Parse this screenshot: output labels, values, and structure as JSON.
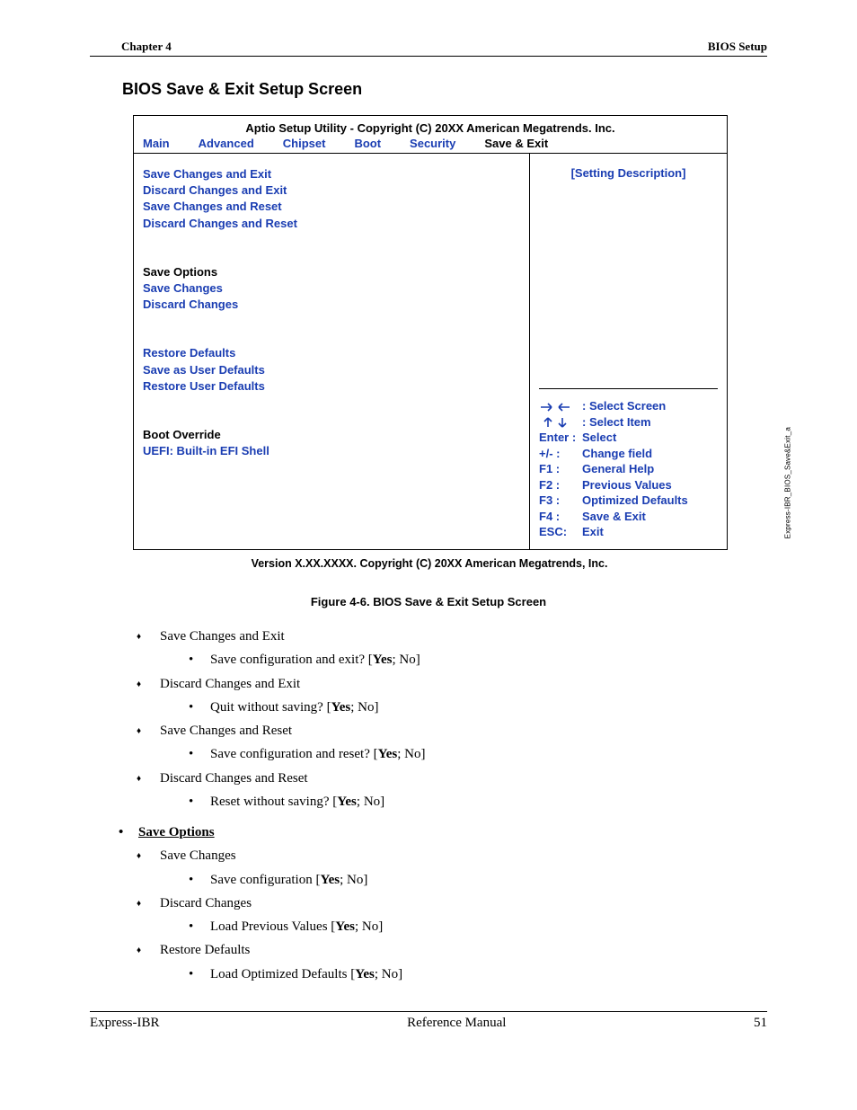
{
  "header": {
    "chapter": "Chapter 4",
    "section": "BIOS Setup"
  },
  "title": "BIOS Save & Exit Setup Screen",
  "bios": {
    "utility_title": "Aptio Setup Utility - Copyright (C) 20XX American Megatrends. Inc.",
    "tabs": [
      "Main",
      "Advanced",
      "Chipset",
      "Boot",
      "Security",
      "Save & Exit"
    ],
    "group1": [
      "Save Changes and Exit",
      "Discard Changes and Exit",
      "Save Changes and Reset",
      "Discard Changes and Reset"
    ],
    "group2_header": "Save Options",
    "group2": [
      "Save Changes",
      "Discard Changes"
    ],
    "group3": [
      "Restore Defaults",
      "Save as User Defaults",
      "Restore User Defaults"
    ],
    "group4_header": "Boot Override",
    "group4": [
      "UEFI: Built-in EFI Shell"
    ],
    "setting_desc": "[Setting Description]",
    "help": {
      "select_screen": "Select Screen",
      "select_item": "Select Item",
      "enter": "Enter :",
      "enter_v": "Select",
      "pm": "+/- :",
      "pm_v": "Change field",
      "f1": "F1 :",
      "f1_v": "General Help",
      "f2": "F2 :",
      "f2_v": "Previous Values",
      "f3": "F3 :",
      "f3_v": "Optimized Defaults",
      "f4": "F4 :",
      "f4_v": "Save & Exit",
      "esc": "ESC:",
      "esc_v": "Exit"
    },
    "version": "Version X.XX.XXXX.  Copyright (C) 20XX  American Megatrends, Inc."
  },
  "sidelabel": "Express-IBR_BIOS_Save&Exit_a",
  "figure_caption": "Figure  4-6.   BIOS Save & Exit Setup Screen",
  "list": {
    "i0": "Save Changes and Exit",
    "i0s_a": "Save configuration and exit? [",
    "i0s_b": "Yes",
    "i0s_c": "; No]",
    "i1": "Discard Changes and Exit",
    "i1s_a": "Quit without saving? [",
    "i1s_b": "Yes",
    "i1s_c": "; No]",
    "i2": "Save Changes and Reset",
    "i2s_a": "Save configuration and reset? [",
    "i2s_b": "Yes",
    "i2s_c": "; No]",
    "i3": "Discard Changes and Reset",
    "i3s_a": "Reset without saving? [",
    "i3s_b": "Yes",
    "i3s_c": "; No]",
    "so": "Save Options",
    "j0": "Save Changes",
    "j0s_a": "Save configuration [",
    "j0s_b": "Yes",
    "j0s_c": "; No]",
    "j1": "Discard Changes",
    "j1s_a": "Load Previous Values [",
    "j1s_b": "Yes",
    "j1s_c": "; No]",
    "j2": "Restore Defaults",
    "j2s_a": "Load Optimized Defaults [",
    "j2s_b": "Yes",
    "j2s_c": "; No]"
  },
  "footer": {
    "left": "Express-IBR",
    "center": "Reference Manual",
    "right": "51"
  }
}
